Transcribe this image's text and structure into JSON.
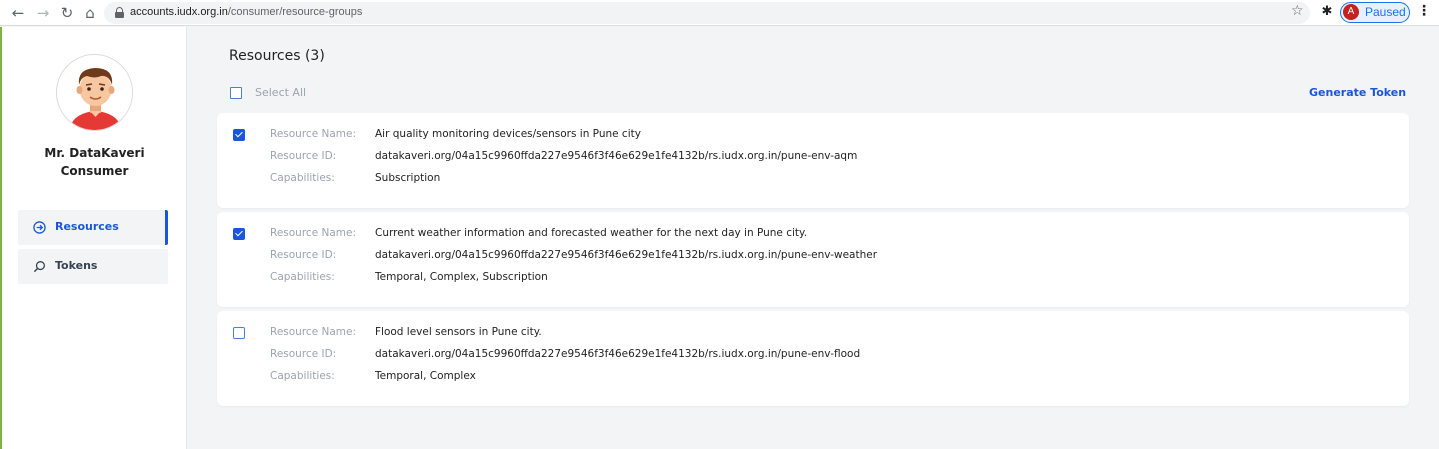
{
  "browser": {
    "url_host": "accounts.iudx.org.in",
    "url_path": "/consumer/resource-groups",
    "profile_initial": "A",
    "profile_status": "Paused"
  },
  "sidebar": {
    "user_name_line1": "Mr. DataKaveri",
    "user_name_line2": "Consumer",
    "items": [
      {
        "label": "Resources",
        "icon": "arrow-right-circle-icon",
        "active": true
      },
      {
        "label": "Tokens",
        "icon": "search-icon",
        "active": false
      }
    ]
  },
  "main": {
    "title": "Resources (3)",
    "select_all_label": "Select All",
    "generate_token_label": "Generate Token",
    "field_labels": {
      "name": "Resource Name:",
      "id": "Resource ID:",
      "capabilities": "Capabilities:"
    },
    "resources": [
      {
        "checked": true,
        "name": "Air quality monitoring devices/sensors in Pune city",
        "id": "datakaveri.org/04a15c9960ffda227e9546f3f46e629e1fe4132b/rs.iudx.org.in/pune-env-aqm",
        "capabilities": "Subscription"
      },
      {
        "checked": true,
        "name": "Current weather information and forecasted weather for the next day in Pune city.",
        "id": "datakaveri.org/04a15c9960ffda227e9546f3f46e629e1fe4132b/rs.iudx.org.in/pune-env-weather",
        "capabilities": "Temporal,  Complex,  Subscription"
      },
      {
        "checked": false,
        "name": "Flood level sensors in Pune city.",
        "id": "datakaveri.org/04a15c9960ffda227e9546f3f46e629e1fe4132b/rs.iudx.org.in/pune-env-flood",
        "capabilities": "Temporal,  Complex"
      }
    ]
  },
  "colors": {
    "accent": "#1a56db",
    "page_bg": "#f3f4f6",
    "label_gray": "#9ca3af"
  }
}
